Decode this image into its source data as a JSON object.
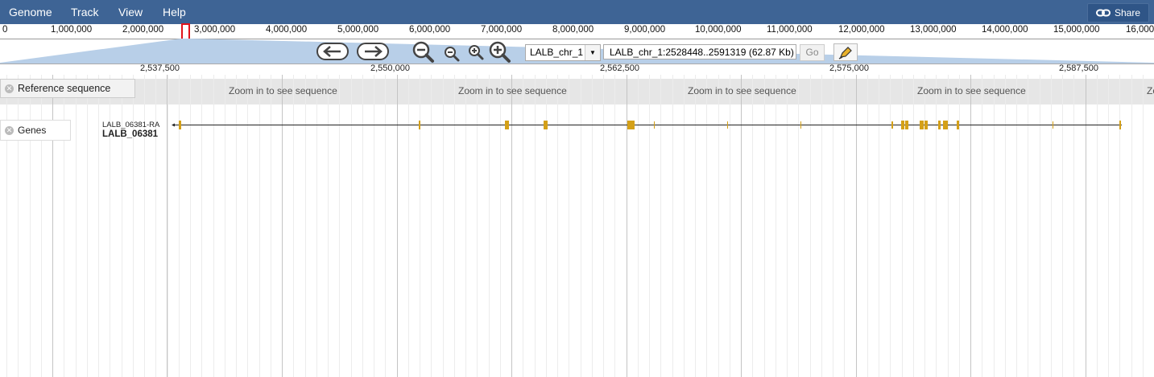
{
  "menu": {
    "genome": "Genome",
    "track": "Track",
    "view": "View",
    "help": "Help",
    "share": "Share"
  },
  "overview_scale": [
    "0",
    "1,000,000",
    "2,000,000",
    "3,000,000",
    "4,000,000",
    "5,000,000",
    "6,000,000",
    "7,000,000",
    "8,000,000",
    "9,000,000",
    "10,000,000",
    "11,000,000",
    "12,000,000",
    "13,000,000",
    "14,000,000",
    "15,000,000",
    "16,000,"
  ],
  "navigation": {
    "chrom_select": "LALB_chr_1",
    "location": "LALB_chr_1:2528448..2591319 (62.87 Kb)",
    "go": "Go"
  },
  "ruler": [
    "2,537,500",
    "2,550,000",
    "2,562,500",
    "2,575,000",
    "2,587,500"
  ],
  "tracks": {
    "reference": {
      "label": "Reference sequence",
      "zoom_text": "Zoom in to see sequence",
      "zoom_text_cut": "Zo"
    },
    "genes": {
      "label": "Genes",
      "transcript": "LALB_06381-RA",
      "gene": "LALB_06381"
    }
  },
  "colors": {
    "menubar": "#3e6495",
    "feature": "#d4a017",
    "highlight": "#e0131b"
  }
}
